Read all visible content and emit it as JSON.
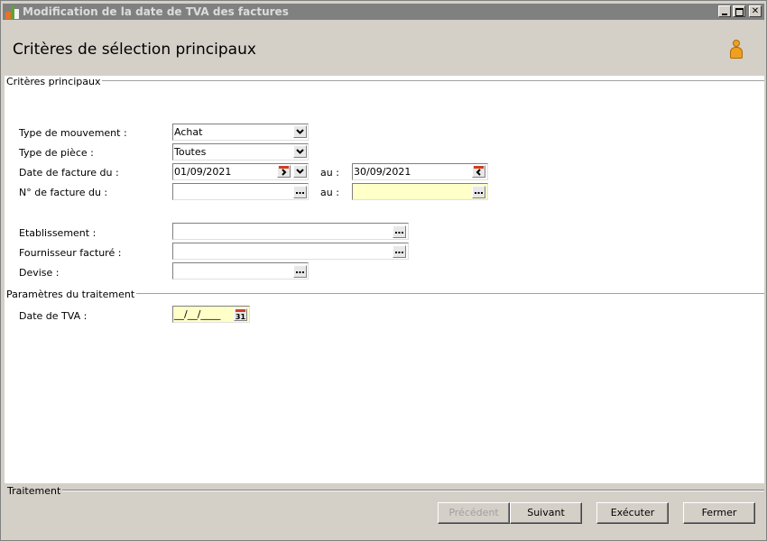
{
  "window": {
    "title": "Modification de la date de TVA des factures",
    "controls": {
      "minimize": "",
      "maximize": "",
      "close": "✕"
    }
  },
  "header": {
    "page_title": "Critères de sélection principaux"
  },
  "sections": {
    "main_criteria": "Critères principaux",
    "treatment_params": "Paramètres du traitement",
    "treatment": "Traitement"
  },
  "form": {
    "type_mouvement": {
      "label": "Type de mouvement :",
      "value": "Achat"
    },
    "type_piece": {
      "label": "Type de pièce :",
      "value": "Toutes"
    },
    "date_facture": {
      "label": "Date de facture du :",
      "from": "01/09/2021",
      "to_label": "au :",
      "to": "30/09/2021"
    },
    "num_facture": {
      "label": "N° de facture du :",
      "from": "",
      "to_label": "au :",
      "to": ""
    },
    "etablissement": {
      "label": "Etablissement :",
      "value": ""
    },
    "fournisseur": {
      "label": "Fournisseur facturé :",
      "value": ""
    },
    "devise": {
      "label": "Devise :",
      "value": ""
    },
    "date_tva": {
      "label": "Date de TVA :",
      "value": "__/__/____",
      "calendar_day": "31"
    }
  },
  "buttons": {
    "precedent": "Précédent",
    "suivant": "Suivant",
    "executer": "Exécuter",
    "fermer": "Fermer"
  },
  "colors": {
    "window_bg": "#d4d0c8",
    "titlebar_bg": "#808080",
    "panel_bg": "#ffffff",
    "required_field_bg": "#ffffc8",
    "calendar_red": "#d04020",
    "user_icon": "#f0a020"
  }
}
